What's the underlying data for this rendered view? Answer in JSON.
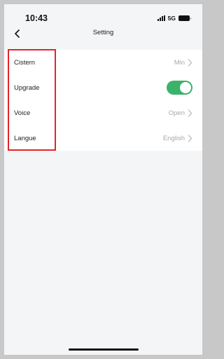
{
  "status_bar": {
    "time": "10:43",
    "network": "5G",
    "signal_icon": "signal-bars-icon",
    "battery_icon": "battery-icon"
  },
  "nav": {
    "back_icon": "chevron-left-icon",
    "title": "Setting"
  },
  "settings": {
    "items": [
      {
        "label": "Cistern",
        "value": "Min",
        "type": "link"
      },
      {
        "label": "Upgrade",
        "value": "",
        "type": "toggle",
        "toggle_on": true
      },
      {
        "label": "Voice",
        "value": "Open",
        "type": "link"
      },
      {
        "label": "Langue",
        "value": "English",
        "type": "link"
      }
    ]
  },
  "colors": {
    "toggle_on": "#3bb26b",
    "highlight_border": "#e2252b",
    "background": "#f4f5f7"
  }
}
